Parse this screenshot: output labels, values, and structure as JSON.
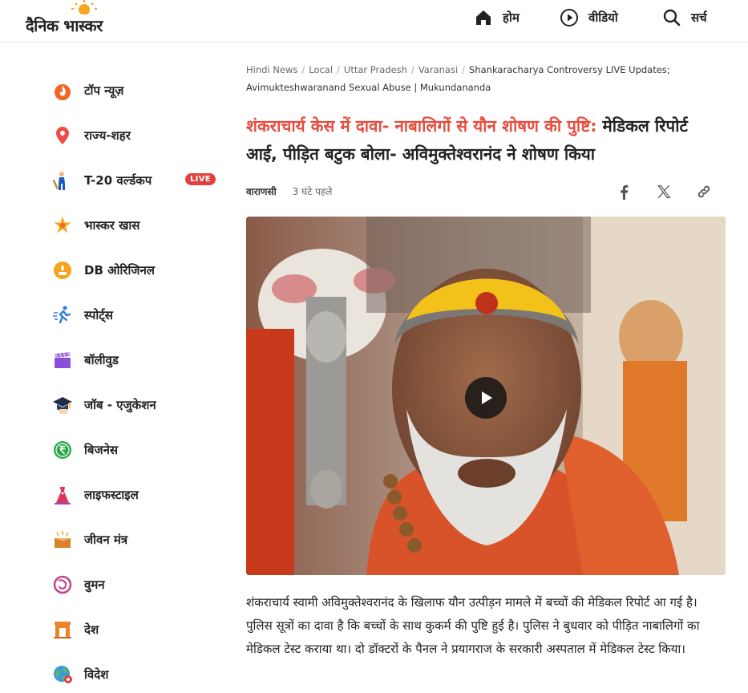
{
  "header": {
    "logo_text": "दैनिक भास्कर",
    "nav": {
      "home": "होम",
      "video": "वीडियो",
      "search": "सर्च"
    }
  },
  "sidebar": {
    "items": [
      {
        "label": "टॉप न्यूज़",
        "icon": "fire-icon"
      },
      {
        "label": "राज्य-शहर",
        "icon": "location-pin-icon"
      },
      {
        "label": "T-20 वर्ल्डकप",
        "icon": "cricket-player-icon",
        "badge": "LIVE"
      },
      {
        "label": "भास्कर खास",
        "icon": "star-icon"
      },
      {
        "label": "DB ओरिजिनल",
        "icon": "db-original-icon"
      },
      {
        "label": "स्पोर्ट्स",
        "icon": "runner-icon"
      },
      {
        "label": "बॉलीवुड",
        "icon": "clapperboard-icon"
      },
      {
        "label": "जॉब - एजुकेशन",
        "icon": "graduation-cap-icon"
      },
      {
        "label": "बिजनेस",
        "icon": "rupee-icon"
      },
      {
        "label": "लाइफस्टाइल",
        "icon": "dress-icon"
      },
      {
        "label": "जीवन मंत्र",
        "icon": "book-icon"
      },
      {
        "label": "वुमन",
        "icon": "woman-icon"
      },
      {
        "label": "देश",
        "icon": "india-gate-icon"
      },
      {
        "label": "विदेश",
        "icon": "globe-icon"
      }
    ]
  },
  "breadcrumb": {
    "items": [
      "Hindi News",
      "Local",
      "Uttar Pradesh",
      "Varanasi"
    ],
    "current": "Shankaracharya Controversy LIVE Updates; Avimukteshwaranand Sexual Abuse | Mukundananda"
  },
  "article": {
    "headline_highlight": "शंकराचार्य केस में दावा- नाबालिगों से यौन शोषण की पुष्टि:",
    "headline_rest": " मेडिकल रिपोर्ट आई, पीड़ित बटुक बोला- अविमुक्तेश्वरानंद ने शोषण किया",
    "place": "वाराणसी",
    "time": "3 घंटे पहले",
    "body": "शंकराचार्य स्वामी अविमुक्तेश्वरानंद के खिलाफ यौन उत्पीड़न मामले में बच्चों की मेडिकल रिपोर्ट आ गई है। पुलिस सूत्रों का दावा है कि बच्चों के साथ कुकर्म की पुष्टि हुई है। पुलिस ने बुधवार को पीड़ित नाबालिगों का मेडिकल टेस्ट कराया था। दो डॉक्टरों के पैनल ने प्रयागराज के सरकारी अस्पताल में मेडिकल टेस्ट किया।"
  },
  "colors": {
    "headline_accent": "#e84c3d",
    "live_badge": "#e04040",
    "text": "#222222"
  }
}
